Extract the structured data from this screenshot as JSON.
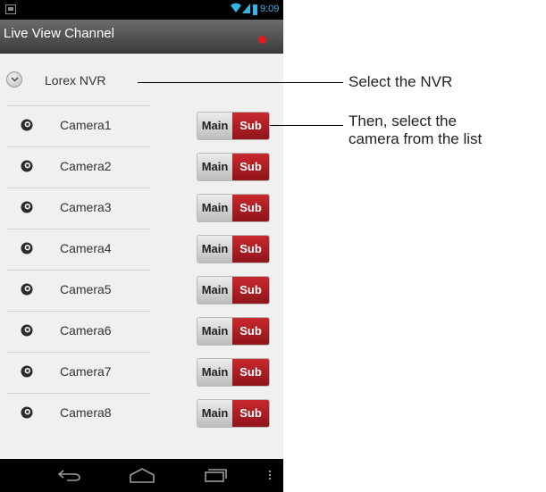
{
  "status_bar": {
    "time": "9:09",
    "accent_color": "#33b5e5"
  },
  "title_bar": {
    "title": "Live View Channel"
  },
  "nvr": {
    "label": "Lorex NVR"
  },
  "cameras": [
    {
      "name": "Camera1",
      "main_label": "Main",
      "sub_label": "Sub"
    },
    {
      "name": "Camera2",
      "main_label": "Main",
      "sub_label": "Sub"
    },
    {
      "name": "Camera3",
      "main_label": "Main",
      "sub_label": "Sub"
    },
    {
      "name": "Camera4",
      "main_label": "Main",
      "sub_label": "Sub"
    },
    {
      "name": "Camera5",
      "main_label": "Main",
      "sub_label": "Sub"
    },
    {
      "name": "Camera6",
      "main_label": "Main",
      "sub_label": "Sub"
    },
    {
      "name": "Camera7",
      "main_label": "Main",
      "sub_label": "Sub"
    },
    {
      "name": "Camera8",
      "main_label": "Main",
      "sub_label": "Sub"
    }
  ],
  "annotations": {
    "select_nvr": "Select the NVR",
    "select_camera_line1": "Then, select the",
    "select_camera_line2": "camera from the list"
  },
  "colors": {
    "sub_button": "#b01e23",
    "record_dot": "#e21c1c"
  }
}
